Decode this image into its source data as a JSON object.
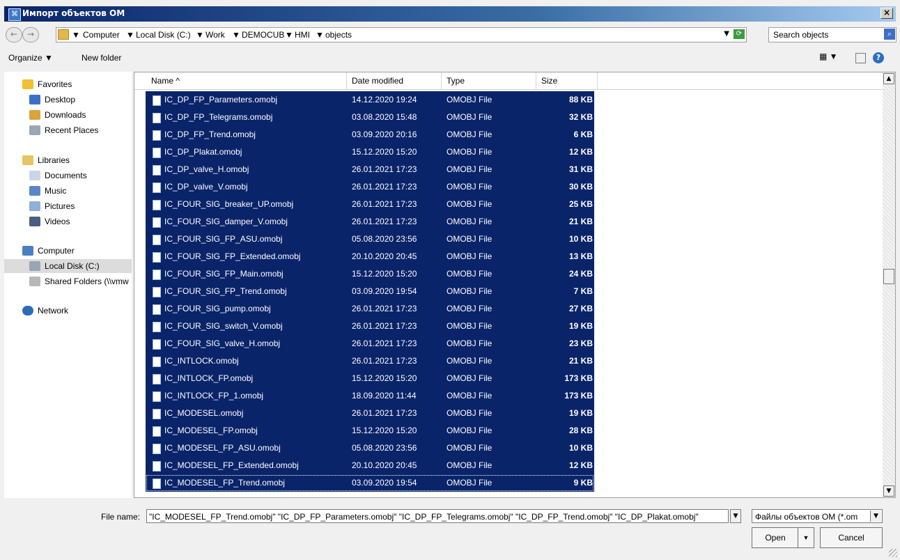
{
  "window": {
    "title": "Импорт объектов ОМ",
    "close_label": "×"
  },
  "address": {
    "back_icon": "←",
    "forward_icon": "→",
    "crumbs": [
      "Computer",
      "Local Disk (C:)",
      "Work",
      "DEMOCUB",
      "HMI",
      "objects"
    ],
    "separator": "▼",
    "dropdown_icon": "▼",
    "refresh_icon": "⟳"
  },
  "search": {
    "placeholder": "Search objects",
    "icon": "⌕"
  },
  "toolbar": {
    "organize": "Organize ▼",
    "new_folder": "New folder",
    "views_icon": "▦ ▼",
    "preview_icon": "□",
    "help_icon": "?"
  },
  "nav": {
    "favorites": "Favorites",
    "desktop": "Desktop",
    "downloads": "Downloads",
    "recent": "Recent Places",
    "libraries": "Libraries",
    "documents": "Documents",
    "music": "Music",
    "pictures": "Pictures",
    "videos": "Videos",
    "computer": "Computer",
    "local_disk": "Local Disk (C:)",
    "shared": "Shared Folders (\\\\vmw",
    "network": "Network"
  },
  "columns": {
    "name": "Name ^",
    "date": "Date modified",
    "type": "Type",
    "size": "Size"
  },
  "files": [
    {
      "name": "IC_DP_FP_Parameters.omobj",
      "date": "14.12.2020 19:24",
      "type": "OMOBJ File",
      "size": "88 KB"
    },
    {
      "name": "IC_DP_FP_Telegrams.omobj",
      "date": "03.08.2020 15:48",
      "type": "OMOBJ File",
      "size": "32 KB"
    },
    {
      "name": "IC_DP_FP_Trend.omobj",
      "date": "03.09.2020 20:16",
      "type": "OMOBJ File",
      "size": "6 KB"
    },
    {
      "name": "IC_DP_Plakat.omobj",
      "date": "15.12.2020 15:20",
      "type": "OMOBJ File",
      "size": "12 KB"
    },
    {
      "name": "IC_DP_valve_H.omobj",
      "date": "26.01.2021 17:23",
      "type": "OMOBJ File",
      "size": "31 KB"
    },
    {
      "name": "IC_DP_valve_V.omobj",
      "date": "26.01.2021 17:23",
      "type": "OMOBJ File",
      "size": "30 KB"
    },
    {
      "name": "IC_FOUR_SIG_breaker_UP.omobj",
      "date": "26.01.2021 17:23",
      "type": "OMOBJ File",
      "size": "25 KB"
    },
    {
      "name": "IC_FOUR_SIG_damper_V.omobj",
      "date": "26.01.2021 17:23",
      "type": "OMOBJ File",
      "size": "21 KB"
    },
    {
      "name": "IC_FOUR_SIG_FP_ASU.omobj",
      "date": "05.08.2020 23:56",
      "type": "OMOBJ File",
      "size": "10 KB"
    },
    {
      "name": "IC_FOUR_SIG_FP_Extended.omobj",
      "date": "20.10.2020 20:45",
      "type": "OMOBJ File",
      "size": "13 KB"
    },
    {
      "name": "IC_FOUR_SIG_FP_Main.omobj",
      "date": "15.12.2020 15:20",
      "type": "OMOBJ File",
      "size": "24 KB"
    },
    {
      "name": "IC_FOUR_SIG_FP_Trend.omobj",
      "date": "03.09.2020 19:54",
      "type": "OMOBJ File",
      "size": "7 KB"
    },
    {
      "name": "IC_FOUR_SIG_pump.omobj",
      "date": "26.01.2021 17:23",
      "type": "OMOBJ File",
      "size": "27 KB"
    },
    {
      "name": "IC_FOUR_SIG_switch_V.omobj",
      "date": "26.01.2021 17:23",
      "type": "OMOBJ File",
      "size": "19 KB"
    },
    {
      "name": "IC_FOUR_SIG_valve_H.omobj",
      "date": "26.01.2021 17:23",
      "type": "OMOBJ File",
      "size": "23 KB"
    },
    {
      "name": "IC_INTLOCK.omobj",
      "date": "26.01.2021 17:23",
      "type": "OMOBJ File",
      "size": "21 KB"
    },
    {
      "name": "IC_INTLOCK_FP.omobj",
      "date": "15.12.2020 15:20",
      "type": "OMOBJ File",
      "size": "173 KB"
    },
    {
      "name": "IC_INTLOCK_FP_1.omobj",
      "date": "18.09.2020 11:44",
      "type": "OMOBJ File",
      "size": "173 KB"
    },
    {
      "name": "IC_MODESEL.omobj",
      "date": "26.01.2021 17:23",
      "type": "OMOBJ File",
      "size": "19 KB"
    },
    {
      "name": "IC_MODESEL_FP.omobj",
      "date": "15.12.2020 15:20",
      "type": "OMOBJ File",
      "size": "28 KB"
    },
    {
      "name": "IC_MODESEL_FP_ASU.omobj",
      "date": "05.08.2020 23:56",
      "type": "OMOBJ File",
      "size": "10 KB"
    },
    {
      "name": "IC_MODESEL_FP_Extended.omobj",
      "date": "20.10.2020 20:45",
      "type": "OMOBJ File",
      "size": "12 KB"
    },
    {
      "name": "IC_MODESEL_FP_Trend.omobj",
      "date": "03.09.2020 19:54",
      "type": "OMOBJ File",
      "size": "9 KB"
    }
  ],
  "footer": {
    "file_name_label": "File name:",
    "file_name_value": "\"IC_MODESEL_FP_Trend.omobj\" \"IC_DP_FP_Parameters.omobj\" \"IC_DP_FP_Telegrams.omobj\" \"IC_DP_FP_Trend.omobj\" \"IC_DP_Plakat.omobj\"",
    "filter": "Файлы объектов ОМ (*.om",
    "open": "Open",
    "cancel": "Cancel",
    "dropdown_icon": "▼"
  },
  "colors": {
    "selection": "#0a246a",
    "title_start": "#0a246a",
    "title_end": "#a6caf0"
  }
}
